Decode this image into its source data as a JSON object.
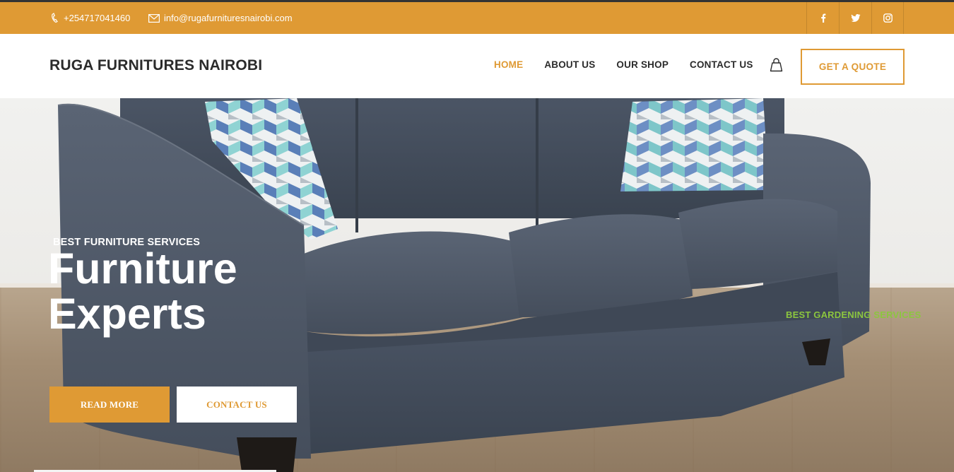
{
  "colors": {
    "accent": "#df9a34",
    "green_text": "#8cc63f",
    "dark_text": "#2b2b2b"
  },
  "topbar": {
    "phone": "+254717041460",
    "email": "info@rugafurnituresnairobi.com",
    "phone_icon": "phone-icon",
    "email_icon": "envelope-icon",
    "social": [
      {
        "icon": "facebook-icon",
        "glyph": "f"
      },
      {
        "icon": "twitter-icon",
        "glyph": "t"
      },
      {
        "icon": "instagram-icon",
        "glyph": "ig"
      }
    ]
  },
  "header": {
    "brand": "RUGA FURNITURES NAIROBI",
    "nav": [
      "HOME",
      "ABOUT US",
      "OUR SHOP",
      "CONTACT US"
    ],
    "active_nav": "HOME",
    "cart_icon": "shopping-bag-icon",
    "quote_button": "GET A QUOTE"
  },
  "hero": {
    "kicker": "BEST FURNITURE SERVICES",
    "headline_line1": "Furniture",
    "headline_line2": "Experts",
    "side_tag": "BEST GARDENING SERVICES",
    "read_more": "READ MORE",
    "contact_us": "CONTACT US"
  }
}
